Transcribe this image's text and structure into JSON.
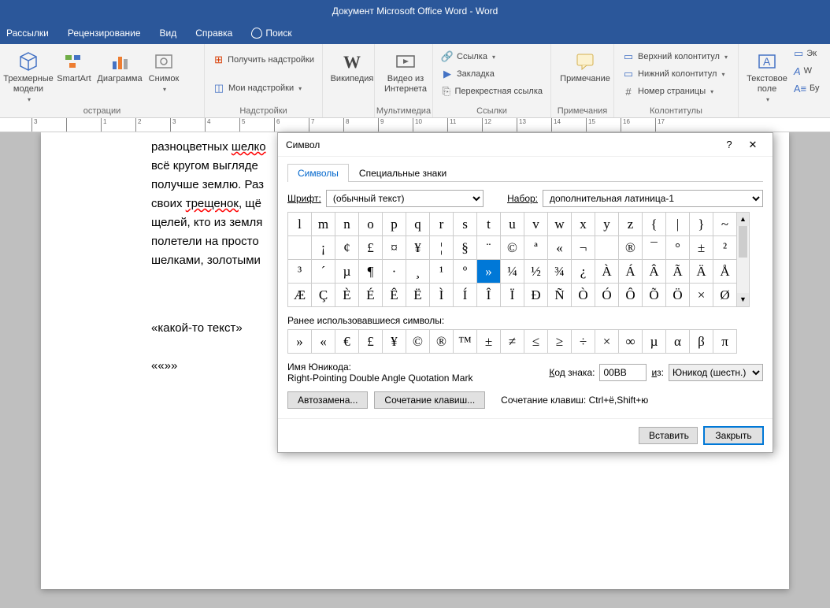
{
  "title": "Документ Microsoft Office Word  -  Word",
  "menu": {
    "m1": "Рассылки",
    "m2": "Рецензирование",
    "m3": "Вид",
    "m4": "Справка",
    "search": "Поиск"
  },
  "ribbon": {
    "g1_label": "острации",
    "b3d": "Трехмерные модели",
    "smartart": "SmartArt",
    "diagram": "Диаграмма",
    "snimok": "Снимок",
    "g2_label": "Надстройки",
    "getaddins": "Получить надстройки",
    "myaddins": "Мои надстройки",
    "wiki": "Википедия",
    "g3_label": "Мультимедиа",
    "video": "Видео из Интернета",
    "g4_label": "Ссылки",
    "link": "Ссылка",
    "bookmark": "Закладка",
    "crossref": "Перекрестная ссылка",
    "g5_label": "Примечания",
    "comment": "Примечание",
    "g6_label": "Колонтитулы",
    "header": "Верхний колонтитул",
    "footer": "Нижний колонтитул",
    "pagenum": "Номер страницы",
    "textbox": "Текстовое поле",
    "ex": "Эк",
    "wa": "W",
    "bu": "Бу"
  },
  "doc": {
    "l1a": "разноцветных ",
    "l1b": "шелко",
    "l2": "всё кругом выгляде",
    "l3": "получше землю. Раз",
    "l4a": "своих ",
    "l4b": "трещенок",
    "l4c": ", щё",
    "l5": "щелей, кто из земля",
    "l6": "полетели на просто",
    "l7": "шелками, золотыми",
    "l8": "«какой-то текст»",
    "l9": "««»»"
  },
  "dialog": {
    "title": "Символ",
    "tab1": "Символы",
    "tab2": "Специальные знаки",
    "font_label": "Шрифт:",
    "font_value": "(обычный текст)",
    "set_label": "Набор:",
    "set_value": "дополнительная латиница-1",
    "grid": [
      [
        "l",
        "m",
        "n",
        "o",
        "p",
        "q",
        "r",
        "s",
        "t",
        "u",
        "v",
        "w",
        "x",
        "y",
        "z",
        "{",
        "|",
        "}",
        "~"
      ],
      [
        "",
        "¡",
        "¢",
        "£",
        "¤",
        "¥",
        "¦",
        "§",
        "¨",
        "©",
        "ª",
        "«",
        "¬",
        "­",
        "®",
        "¯",
        "°",
        "±",
        "²"
      ],
      [
        "³",
        "´",
        "µ",
        "¶",
        "·",
        "¸",
        "¹",
        "º",
        "»",
        "¼",
        "½",
        "¾",
        "¿",
        "À",
        "Á",
        "Â",
        "Ã",
        "Ä",
        "Å"
      ],
      [
        "Æ",
        "Ç",
        "È",
        "É",
        "Ê",
        "Ë",
        "Ì",
        "Í",
        "Î",
        "Ï",
        "Ð",
        "Ñ",
        "Ò",
        "Ó",
        "Ô",
        "Õ",
        "Ö",
        "×",
        "Ø"
      ]
    ],
    "selected_row": 2,
    "selected_col": 8,
    "recent_label": "Ранее использовавшиеся символы:",
    "recent": [
      "»",
      "«",
      "€",
      "£",
      "¥",
      "©",
      "®",
      "™",
      "±",
      "≠",
      "≤",
      "≥",
      "÷",
      "×",
      "∞",
      "µ",
      "α",
      "β",
      "π"
    ],
    "uname_label": "Имя Юникода:",
    "uname_value": "Right-Pointing Double Angle Quotation Mark",
    "code_label": "Код знака:",
    "code_value": "00BB",
    "from_label": "из:",
    "from_value": "Юникод (шестн.)",
    "autocorrect": "Автозамена...",
    "shortcut_btn": "Сочетание клавиш...",
    "shortcut_label": "Сочетание клавиш: Ctrl+ё,Shift+ю",
    "insert": "Вставить",
    "close": "Закрыть"
  }
}
